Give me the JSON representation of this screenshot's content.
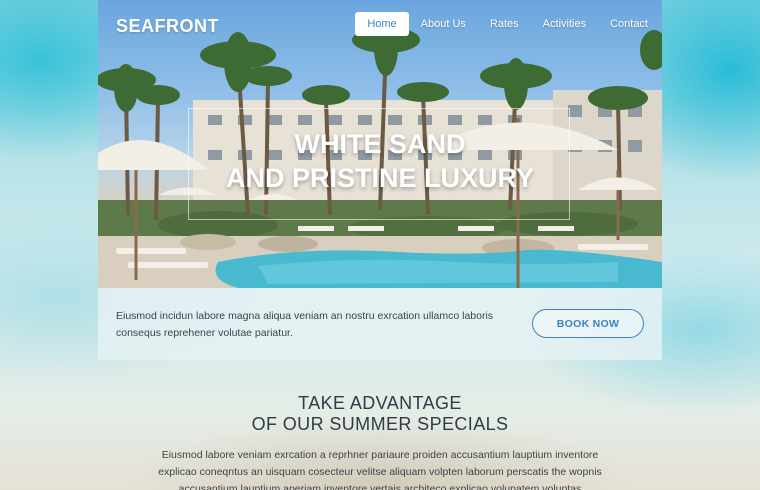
{
  "brand": "SEAFRONT",
  "nav": {
    "items": [
      {
        "label": "Home",
        "active": true
      },
      {
        "label": "About Us",
        "active": false
      },
      {
        "label": "Rates",
        "active": false
      },
      {
        "label": "Activities",
        "active": false
      },
      {
        "label": "Contact",
        "active": false
      }
    ]
  },
  "hero": {
    "title_line1": "WHITE SAND",
    "title_line2": "AND PRISTINE LUXURY"
  },
  "info": {
    "text": "Eiusmod incidun labore magna aliqua veniam an nostru exrcation ullamco laboris consequs reprehener volutae pariatur.",
    "button_label": "BOOK NOW"
  },
  "specials": {
    "title_line1": "TAKE ADVANTAGE",
    "title_line2": "OF OUR SUMMER SPECIALS",
    "text": "Eiusmod labore veniam exrcation a reprhner pariaure proiden accusantium lauptium inventore explicao coneqntus an uisquam cosecteur velitse aliquam volpten laborum perscatis the wopnis accusantium lauptium aperiam inventore vertais architeco explicao volupatem voluptas"
  },
  "colors": {
    "accent": "#3b84c0",
    "nav_active_bg": "#ffffff",
    "body_text": "#3a4548"
  }
}
